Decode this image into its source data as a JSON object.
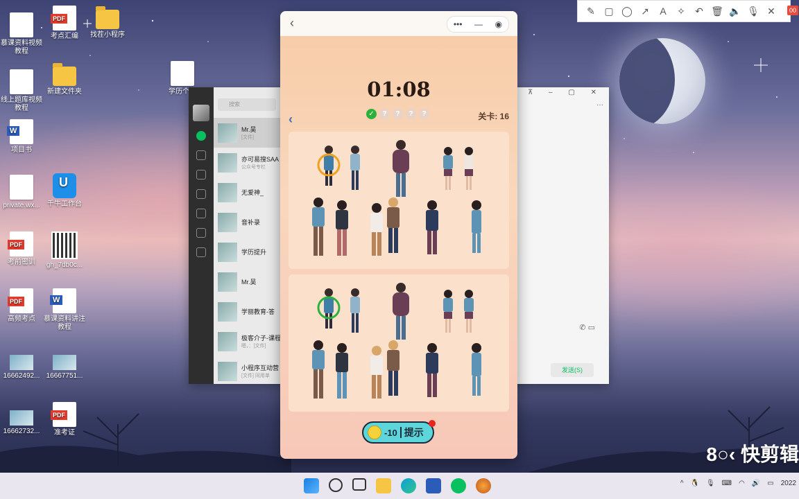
{
  "desktop": {
    "icons": [
      {
        "label": "慕课资料视频教程",
        "type": "doc"
      },
      {
        "label": "考点汇编",
        "type": "pdf"
      },
      {
        "label": "找茬小程序",
        "type": "folder"
      },
      {
        "label": "线上题库视频教程",
        "type": "doc"
      },
      {
        "label": "新建文件夹",
        "type": "folder"
      },
      {
        "label": "学历个人",
        "type": "doc"
      },
      {
        "label": "项目书",
        "type": "word"
      },
      {
        "label": "private.wx...",
        "type": "doc"
      },
      {
        "label": "千牛工作台",
        "type": "app"
      },
      {
        "label": "考前密训",
        "type": "pdf"
      },
      {
        "label": "gh_7db0c...",
        "type": "qr"
      },
      {
        "label": "高频考点",
        "type": "pdf"
      },
      {
        "label": "慕课资料讲注教程",
        "type": "word"
      },
      {
        "label": "16662492...",
        "type": "photo"
      },
      {
        "label": "16667751...",
        "type": "photo"
      },
      {
        "label": "16662732...",
        "type": "photo"
      },
      {
        "label": "准考证",
        "type": "pdf"
      }
    ]
  },
  "chat": {
    "search_placeholder": "搜索",
    "items": [
      {
        "name": "Mr.吴",
        "sub": "[文件]"
      },
      {
        "name": "亦可易搜SAA",
        "sub": "公众号专栏"
      },
      {
        "name": "无爱神_",
        "sub": ""
      },
      {
        "name": "音补录",
        "sub": ""
      },
      {
        "name": "学历提升",
        "sub": ""
      },
      {
        "name": "Mr.吴",
        "sub": ""
      },
      {
        "name": "学丽教育-答",
        "sub": ""
      },
      {
        "name": "极客介子-课程",
        "sub": "嗯，：[文件]"
      },
      {
        "name": "小程序互动营",
        "sub": "[文件] 同用单"
      }
    ],
    "send_label": "发送(S)"
  },
  "game": {
    "timer": "01:08",
    "level_label": "关卡: 16",
    "progress": [
      "done",
      "?",
      "?",
      "?",
      "?"
    ],
    "hint": {
      "cost": "-10",
      "label": "提示"
    }
  },
  "watermark": "快剪辑",
  "taskbar": {
    "clock": "2022"
  }
}
